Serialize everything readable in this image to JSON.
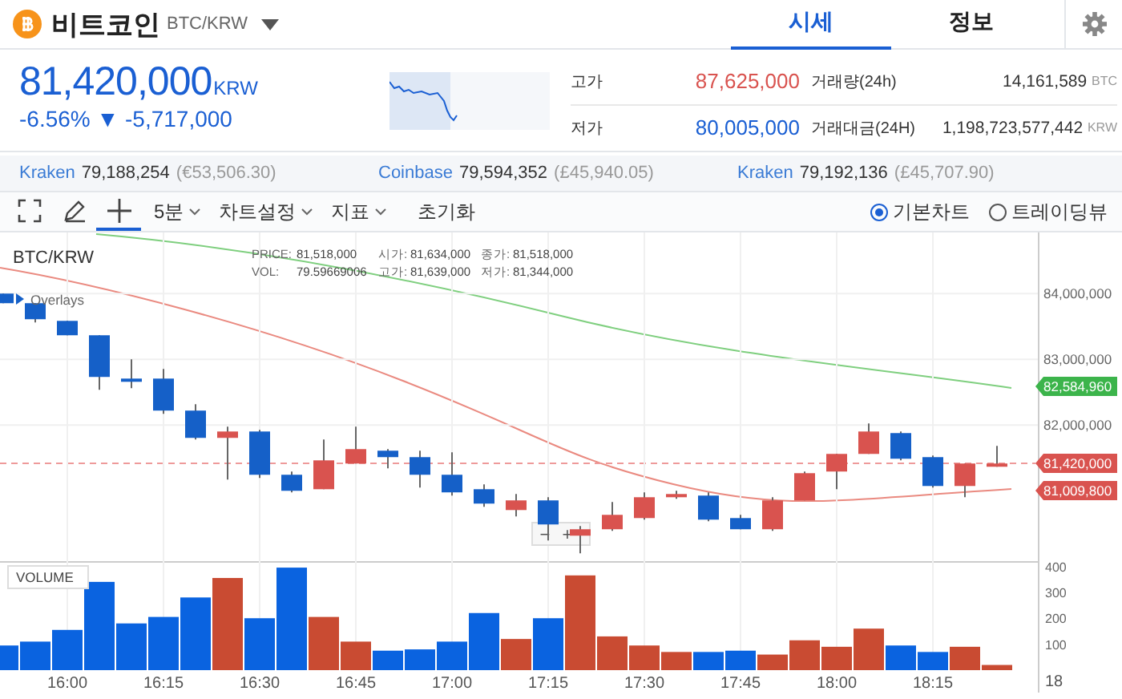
{
  "header": {
    "coin_name": "비트코인",
    "pair": "BTC/KRW",
    "tabs": [
      {
        "label": "시세",
        "selected": true
      },
      {
        "label": "정보",
        "selected": false
      }
    ]
  },
  "price": {
    "value": "81,420,000",
    "currency": "KRW",
    "change_percent": "-6.56%",
    "arrow": "▼",
    "change_amount": "-5,717,000"
  },
  "stats": [
    {
      "label": "고가",
      "value": "87,625,000",
      "kind": "high"
    },
    {
      "label": "거래량(24h)",
      "value": "14,161,589",
      "unit": "BTC",
      "kind": "plain"
    },
    {
      "label": "저가",
      "value": "80,005,000",
      "kind": "low"
    },
    {
      "label": "거래대금(24H)",
      "value": "1,198,723,577,442",
      "unit": "KRW",
      "kind": "plain"
    }
  ],
  "exchanges": [
    {
      "name": "Kraken",
      "price": "79,188,254",
      "fx": "(€53,506.30)"
    },
    {
      "name": "Coinbase",
      "price": "79,594,352",
      "fx": "(£45,940.05)"
    },
    {
      "name": "Kraken",
      "price": "79,192,136",
      "fx": "(£45,707.90)"
    }
  ],
  "toolbar": {
    "tools": [
      {
        "kind": "fullscreen",
        "selected": false
      },
      {
        "kind": "pencil",
        "selected": false
      },
      {
        "kind": "crosshair",
        "selected": true
      }
    ],
    "menus": [
      {
        "label": "5분"
      },
      {
        "label": "차트설정"
      },
      {
        "label": "지표"
      }
    ],
    "reset": "초기화",
    "chart_types": [
      {
        "label": "기본차트",
        "selected": true
      },
      {
        "label": "트레이딩뷰",
        "selected": false
      }
    ]
  },
  "chart": {
    "symbol": "BTC/KRW",
    "legend": [
      {
        "label": "PRICE:",
        "value": "81,518,000"
      },
      {
        "label": "시가:",
        "value": "81,634,000"
      },
      {
        "label": "종가:",
        "value": "81,518,000"
      },
      {
        "label": "VOL:",
        "value": "79.59669006"
      },
      {
        "label": "고가:",
        "value": "81,639,000"
      },
      {
        "label": "저가:",
        "value": "81,344,000"
      }
    ],
    "overlays": "Overlays",
    "price_tags": [
      {
        "value": "82,584,960",
        "color": "#3cb44b"
      },
      {
        "value": "81,420,000",
        "color": "#d9534f"
      },
      {
        "value": "81,009,800",
        "color": "#d9534f"
      }
    ],
    "zoom_buttons": [
      "−",
      "+"
    ],
    "chart_data": {
      "type": "candlestick",
      "grid": true,
      "x": [
        950,
        955,
        960,
        965,
        970,
        975,
        980,
        985,
        990,
        995,
        1000,
        1005,
        1010,
        1015,
        1020,
        1025,
        1030,
        1035,
        1040,
        1045,
        1050,
        1055,
        1060,
        1065,
        1070,
        1075,
        1080,
        1085,
        1090,
        1095,
        1100,
        1105
      ],
      "ohlc": [
        [
          84000000,
          84000000,
          83854000,
          83854000
        ],
        [
          83854000,
          83854000,
          83561000,
          83610000
        ],
        [
          83585000,
          83585000,
          83366000,
          83366000
        ],
        [
          83366000,
          83366000,
          82537000,
          82732000
        ],
        [
          82707000,
          83000000,
          82561000,
          82659000
        ],
        [
          82707000,
          82854000,
          82171000,
          82220000
        ],
        [
          82220000,
          82317000,
          81780000,
          81805000
        ],
        [
          81805000,
          81976000,
          81171000,
          81902000
        ],
        [
          81902000,
          81927000,
          81195000,
          81244000
        ],
        [
          81244000,
          81293000,
          80976000,
          81000000
        ],
        [
          81024000,
          81780000,
          81024000,
          81463000
        ],
        [
          81415000,
          81976000,
          81415000,
          81634000
        ],
        [
          81610000,
          81634000,
          81341000,
          81512000
        ],
        [
          81512000,
          81610000,
          81049000,
          81244000
        ],
        [
          81244000,
          81585000,
          80927000,
          80976000
        ],
        [
          81024000,
          81098000,
          80756000,
          80805000
        ],
        [
          80707000,
          80951000,
          80610000,
          80854000
        ],
        [
          80854000,
          80902000,
          80244000,
          80488000
        ],
        [
          80317000,
          80463000,
          80049000,
          80415000
        ],
        [
          80415000,
          80829000,
          80390000,
          80634000
        ],
        [
          80585000,
          80976000,
          80561000,
          80902000
        ],
        [
          80902000,
          81000000,
          80878000,
          80951000
        ],
        [
          80927000,
          80976000,
          80537000,
          80561000
        ],
        [
          80585000,
          80634000,
          80415000,
          80415000
        ],
        [
          80415000,
          80902000,
          80390000,
          80854000
        ],
        [
          80854000,
          81293000,
          80854000,
          81268000
        ],
        [
          81293000,
          81561000,
          81024000,
          81561000
        ],
        [
          81561000,
          82024000,
          81561000,
          81902000
        ],
        [
          81878000,
          81902000,
          81463000,
          81488000
        ],
        [
          81512000,
          81537000,
          81049000,
          81073000
        ],
        [
          81073000,
          81415000,
          80902000,
          81415000
        ],
        [
          81366000,
          81683000,
          81366000,
          81415000
        ]
      ],
      "xlim": [
        949.5,
        1111.5
      ],
      "ylim": [
        79930000,
        84930000
      ],
      "yticks": [
        {
          "value": 84000000,
          "label": "84,000,000"
        },
        {
          "value": 83000000,
          "label": "83,000,000"
        },
        {
          "value": 82000000,
          "label": "82,000,000"
        }
      ]
    },
    "volume": {
      "label": "VOLUME",
      "edge_time_label": "18",
      "chart_data": {
        "type": "bar",
        "grid": true,
        "x": [
          950,
          955,
          960,
          965,
          970,
          975,
          980,
          985,
          990,
          995,
          1000,
          1005,
          1010,
          1015,
          1020,
          1025,
          1030,
          1035,
          1040,
          1045,
          1050,
          1055,
          1060,
          1065,
          1070,
          1075,
          1080,
          1085,
          1090,
          1095,
          1100,
          1105
        ],
        "series": [
          {
            "color": "#0a63e0",
            "values": [
              95,
              110,
              155,
              340,
              180,
              205,
              280,
              null,
              200,
              395,
              null,
              null,
              75,
              80,
              110,
              220,
              null,
              200,
              null,
              null,
              null,
              null,
              70,
              75,
              null,
              null,
              null,
              null,
              95,
              70,
              null,
              null
            ]
          },
          {
            "color": "#c94b32",
            "values": [
              null,
              null,
              null,
              null,
              null,
              null,
              null,
              355,
              null,
              null,
              205,
              110,
              null,
              null,
              null,
              null,
              120,
              null,
              365,
              130,
              95,
              70,
              null,
              null,
              60,
              115,
              90,
              160,
              null,
              null,
              90,
              20
            ]
          }
        ],
        "xlim": [
          949.5,
          1111.5
        ],
        "ylim": [
          0,
          420
        ],
        "yticks": [
          100,
          200,
          300,
          400
        ],
        "xticks": [
          {
            "value": 960,
            "label": "16:00"
          },
          {
            "value": 975,
            "label": "16:15"
          },
          {
            "value": 990,
            "label": "16:30"
          },
          {
            "value": 1005,
            "label": "16:45"
          },
          {
            "value": 1020,
            "label": "17:00"
          },
          {
            "value": 1035,
            "label": "17:15"
          },
          {
            "value": 1050,
            "label": "17:30"
          },
          {
            "value": 1065,
            "label": "17:45"
          },
          {
            "value": 1080,
            "label": "18:00"
          },
          {
            "value": 1095,
            "label": "18:15"
          }
        ]
      }
    }
  }
}
